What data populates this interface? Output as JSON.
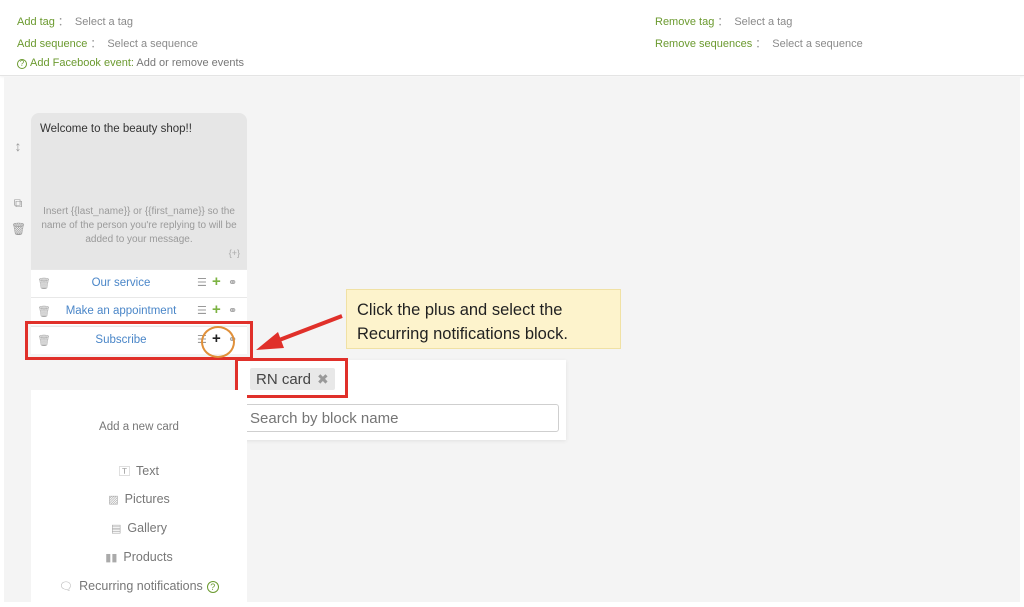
{
  "settings": {
    "add_tag": {
      "label": "Add tag",
      "sep": "：",
      "value": "Select a tag"
    },
    "add_sequence": {
      "label": "Add sequence",
      "sep": "：",
      "value": "Select a sequence"
    },
    "add_fb_event": {
      "label": "Add Facebook event:",
      "value": "Add or remove events"
    },
    "remove_tag": {
      "label": "Remove tag",
      "sep": "：",
      "value": "Select a tag"
    },
    "remove_sequences": {
      "label": "Remove sequences",
      "sep": "：",
      "value": "Select a sequence"
    }
  },
  "message": {
    "text": "Welcome to the beauty shop!!",
    "hint": "Insert {{last_name}} or {{first_name}} so the name of the person you're replying to will be added to your message.",
    "insert": "{+}"
  },
  "buttons": [
    {
      "title": "Our service"
    },
    {
      "title": "Make an appointment"
    },
    {
      "title": "Subscribe"
    }
  ],
  "callout": {
    "text": "Click the plus and select the Recurring notifications block."
  },
  "dropdown": {
    "chip": "RN card",
    "chip_remove": "✖",
    "search_placeholder": "Search by block name"
  },
  "add_card": {
    "heading": "Add a new card",
    "options": [
      {
        "label": "Text",
        "icon": "text-icon"
      },
      {
        "label": "Pictures",
        "icon": "picture-icon"
      },
      {
        "label": "Gallery",
        "icon": "gallery-icon"
      },
      {
        "label": "Products",
        "icon": "products-icon"
      },
      {
        "label": "Recurring notifications",
        "icon": "notification-icon"
      }
    ]
  },
  "colors": {
    "accent_green": "#6b9a2f",
    "link_blue": "#4a86c8",
    "highlight_red": "#e0302a",
    "callout_bg": "#fdf3cc"
  }
}
